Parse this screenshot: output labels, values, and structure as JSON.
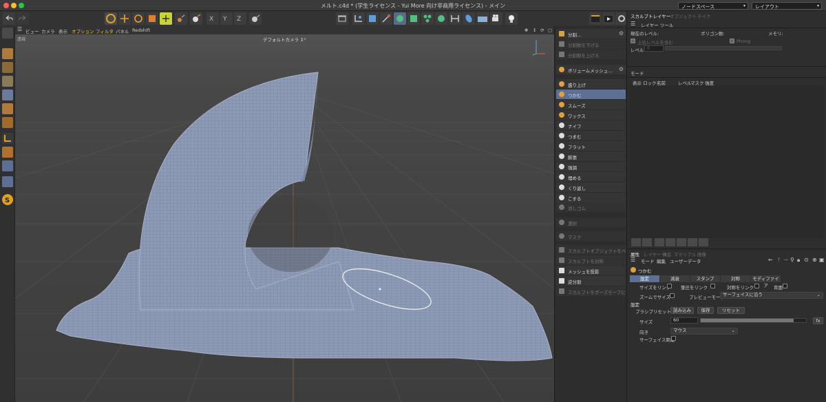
{
  "window": {
    "title": "メルト.c4d * (学生ライセンス - Yui More 向け非商用ライセンス) - メイン",
    "node_space_select": "ノードスペース",
    "layout_select": "レイアウト"
  },
  "viewport": {
    "menu": [
      "ビュー",
      "カメラ",
      "表示",
      "オプション",
      "フィルタ",
      "パネル",
      "Redshift"
    ],
    "left_label": "透視",
    "camera_label": "デフォルトカメラ ↕°"
  },
  "brush_panel": {
    "top_items": [
      {
        "label": "分割...",
        "enabled": true
      },
      {
        "label": "分割数を下げる",
        "enabled": false
      },
      {
        "label": "分割数を上げる",
        "enabled": false
      }
    ],
    "volume_item": "ボリュームメッシュ...",
    "brushes": [
      {
        "label": "盛り上げ",
        "selected": false
      },
      {
        "label": "つかむ",
        "selected": true
      },
      {
        "label": "スムーズ",
        "selected": false
      },
      {
        "label": "ワックス",
        "selected": false
      },
      {
        "label": "ナイフ",
        "selected": false
      },
      {
        "label": "つまむ",
        "selected": false
      },
      {
        "label": "フラット",
        "selected": false
      },
      {
        "label": "膨張",
        "selected": false
      },
      {
        "label": "強調",
        "selected": false
      },
      {
        "label": "埋める",
        "selected": false
      },
      {
        "label": "くり返し",
        "selected": false
      },
      {
        "label": "こする",
        "selected": false
      }
    ],
    "extra_items": [
      {
        "label": "消しゴム",
        "enabled": false
      },
      {
        "label": "選択",
        "enabled": false
      },
      {
        "label": "マスク",
        "enabled": false
      }
    ],
    "bottom_items": [
      {
        "label": "スカルプトオブジェクトをベイク",
        "enabled": false
      },
      {
        "label": "スカルプトを対称",
        "enabled": false
      },
      {
        "label": "メッシュを投影",
        "enabled": true
      },
      {
        "label": "逆分割",
        "enabled": true
      },
      {
        "label": "スカルプトをポーズモーフに",
        "enabled": false
      }
    ]
  },
  "right_panel": {
    "top_tabs": [
      "スカルプトレイヤー",
      "オブジェクト",
      "テイク"
    ],
    "sub_tabs": [
      "レイヤー",
      "ツール"
    ],
    "current_level_label": "現在のレベル:",
    "polygon_count_label": "ポリゴン数:",
    "memory_label": "メモリ:",
    "include_upper_label": "上位レベルを含む",
    "phong_label": "Phong",
    "level_label": "レベル",
    "level_value": "0",
    "mode_label": "モード",
    "layer_columns": [
      "表示",
      "ロック",
      "名前",
      "レベル",
      "マスク",
      "強度"
    ],
    "attr_tabs": [
      "属性",
      "レイヤー",
      "構造",
      "マテリアル",
      "画像"
    ],
    "attr_menu": [
      "モード",
      "編集",
      "ユーザーデータ"
    ],
    "tool_name": "つかむ",
    "settings_tabs": [
      "設定",
      "減衰",
      "スタンプ",
      "対称",
      "モディファイア"
    ],
    "link_size": "サイズをリンク",
    "link_pressure": "筆圧をリンク",
    "link_symmetry": "対称をリンク",
    "backface": "背面",
    "zoom_size": "ズームでサイズ",
    "preview_mode_label": "プレビューモード",
    "preview_mode_value": "サーフェイスに沿う",
    "section_settings": "設定",
    "brush_preset_label": "ブラシプリセット",
    "load_btn": "読み込み",
    "save_btn": "保存",
    "reset_btn": "リセット",
    "size_label": "サイズ",
    "size_value": "60",
    "size_fraction": 0.88,
    "fx_label": "fx",
    "direction_label": "向き",
    "direction_value": "マウス",
    "surface_distance_label": "サーフェイス距離"
  },
  "colors": {
    "accent": "#5d6f92",
    "mesh": "#8c9ab5",
    "mesh_line": "#5b6a88",
    "brush_circle": "#f0f0f0"
  }
}
